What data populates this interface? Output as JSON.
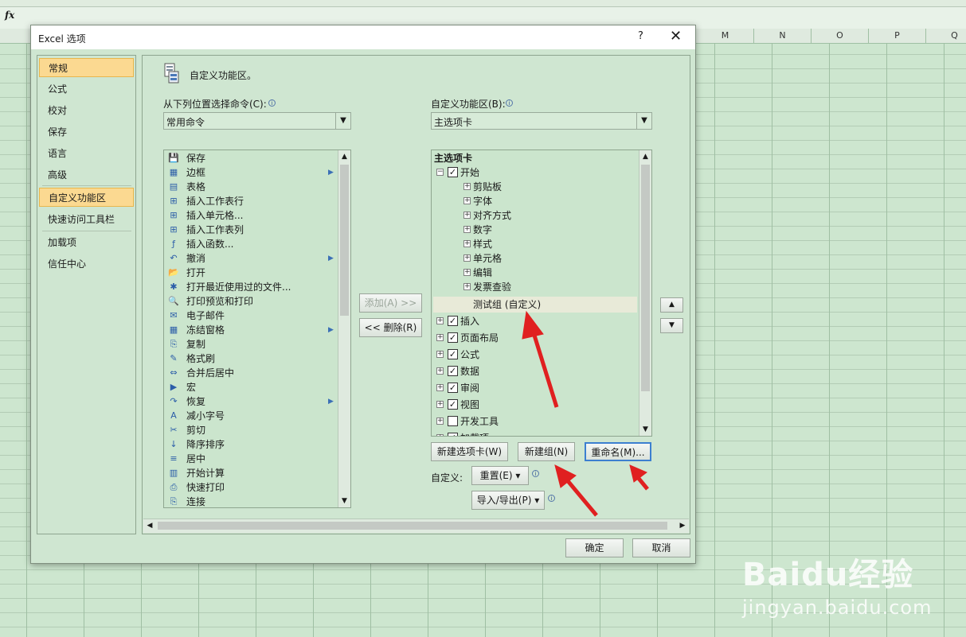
{
  "sheet": {
    "fx_label": "fx",
    "columns": [
      "M",
      "N",
      "O",
      "P",
      "Q"
    ]
  },
  "dialog": {
    "title": "Excel 选项",
    "help": "?",
    "close": "✕",
    "nav": [
      {
        "label": "常规",
        "selected": true
      },
      {
        "label": "公式"
      },
      {
        "label": "校对"
      },
      {
        "label": "保存"
      },
      {
        "label": "语言"
      },
      {
        "label": "高级"
      },
      {
        "label": "自定义功能区",
        "selected": true
      },
      {
        "label": "快速访问工具栏"
      },
      {
        "label": "加载项"
      },
      {
        "label": "信任中心"
      }
    ],
    "heading": "自定义功能区。",
    "left_label": "从下列位置选择命令(C):",
    "left_combo": "常用命令",
    "right_label": "自定义功能区(B):",
    "right_combo": "主选项卡",
    "commands": [
      {
        "label": "保存",
        "icon": "💾"
      },
      {
        "label": "边框",
        "icon": "▦",
        "sub": true
      },
      {
        "label": "表格",
        "icon": "▤"
      },
      {
        "label": "插入工作表行",
        "icon": "⊞"
      },
      {
        "label": "插入单元格...",
        "icon": "⊞"
      },
      {
        "label": "插入工作表列",
        "icon": "⊞"
      },
      {
        "label": "插入函数...",
        "icon": "ƒ"
      },
      {
        "label": "撤消",
        "icon": "↶",
        "sub": true
      },
      {
        "label": "打开",
        "icon": "📂"
      },
      {
        "label": "打开最近使用过的文件...",
        "icon": "✱"
      },
      {
        "label": "打印预览和打印",
        "icon": "🔍"
      },
      {
        "label": "电子邮件",
        "icon": "✉"
      },
      {
        "label": "冻结窗格",
        "icon": "▦",
        "sub": true
      },
      {
        "label": "复制",
        "icon": "⎘"
      },
      {
        "label": "格式刷",
        "icon": "✎"
      },
      {
        "label": "合并后居中",
        "icon": "⇔"
      },
      {
        "label": "宏",
        "icon": "▶"
      },
      {
        "label": "恢复",
        "icon": "↷",
        "sub": true
      },
      {
        "label": "减小字号",
        "icon": "A"
      },
      {
        "label": "剪切",
        "icon": "✂"
      },
      {
        "label": "降序排序",
        "icon": "↓"
      },
      {
        "label": "居中",
        "icon": "≡"
      },
      {
        "label": "开始计算",
        "icon": "▥"
      },
      {
        "label": "快速打印",
        "icon": "⎙"
      },
      {
        "label": "连接",
        "icon": "⎘"
      }
    ],
    "tree_header": "主选项卡",
    "tree": [
      {
        "label": "开始",
        "level": 0,
        "exp": "⊟",
        "checked": true
      },
      {
        "label": "剪贴板",
        "level": 1,
        "exp": "⊞"
      },
      {
        "label": "字体",
        "level": 1,
        "exp": "⊞"
      },
      {
        "label": "对齐方式",
        "level": 1,
        "exp": "⊞"
      },
      {
        "label": "数字",
        "level": 1,
        "exp": "⊞"
      },
      {
        "label": "样式",
        "level": 1,
        "exp": "⊞"
      },
      {
        "label": "单元格",
        "level": 1,
        "exp": "⊞"
      },
      {
        "label": "编辑",
        "level": 1,
        "exp": "⊞"
      },
      {
        "label": "发票查验",
        "level": 1,
        "exp": "⊞"
      },
      {
        "label": "测试组 (自定义)",
        "level": 1,
        "exp": "",
        "selected": true
      },
      {
        "label": "插入",
        "level": 0,
        "exp": "⊞",
        "checked": true
      },
      {
        "label": "页面布局",
        "level": 0,
        "exp": "⊞",
        "checked": true
      },
      {
        "label": "公式",
        "level": 0,
        "exp": "⊞",
        "checked": true
      },
      {
        "label": "数据",
        "level": 0,
        "exp": "⊞",
        "checked": true
      },
      {
        "label": "审阅",
        "level": 0,
        "exp": "⊞",
        "checked": true
      },
      {
        "label": "视图",
        "level": 0,
        "exp": "⊞",
        "checked": true
      },
      {
        "label": "开发工具",
        "level": 0,
        "exp": "⊞",
        "checked": false
      },
      {
        "label": "加载项",
        "level": 0,
        "exp": "⊞",
        "checked": true
      }
    ],
    "add_button": "添加(A) >>",
    "remove_button": "<< 删除(R)",
    "new_tab_button": "新建选项卡(W)",
    "new_group_button": "新建组(N)",
    "rename_button": "重命名(M)...",
    "customize_label": "自定义:",
    "reset_button": "重置(E) ▾",
    "import_export_button": "导入/导出(P) ▾",
    "ok_button": "确定",
    "cancel_button": "取消",
    "up_arrow": "▲",
    "down_arrow": "▼"
  },
  "watermark": {
    "logo": "Baidu经验",
    "url": "jingyan.baidu.com"
  },
  "colors": {
    "accent_red": "#e02020",
    "nav_selected": "#fbd991",
    "bg_green": "#cfe6d1"
  }
}
